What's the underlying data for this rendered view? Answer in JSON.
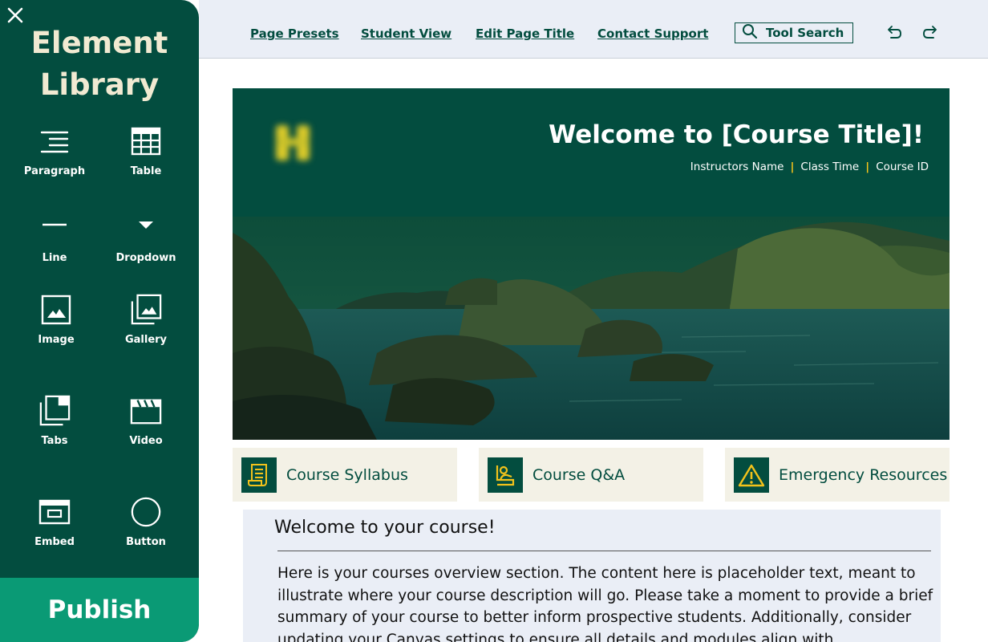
{
  "sidebar": {
    "title_line1": "Element",
    "title_line2": "Library",
    "items": [
      {
        "label": "Paragraph",
        "icon": "paragraph-icon"
      },
      {
        "label": "Table",
        "icon": "table-icon"
      },
      {
        "label": "Line",
        "icon": "line-icon"
      },
      {
        "label": "Dropdown",
        "icon": "dropdown-icon"
      },
      {
        "label": "Image",
        "icon": "image-icon"
      },
      {
        "label": "Gallery",
        "icon": "gallery-icon"
      },
      {
        "label": "Tabs",
        "icon": "tabs-icon"
      },
      {
        "label": "Video",
        "icon": "video-icon"
      },
      {
        "label": "Embed",
        "icon": "embed-icon"
      },
      {
        "label": "Button",
        "icon": "button-icon"
      }
    ],
    "publish_label": "Publish"
  },
  "topbar": {
    "links": [
      "Page Presets",
      "Student View",
      "Edit Page Title",
      "Contact Support"
    ],
    "tool_search_label": "Tool Search"
  },
  "banner": {
    "title": "Welcome to [Course Title]!",
    "meta": [
      "Instructors Name",
      "Class Time",
      "Course ID"
    ]
  },
  "quick_links": [
    {
      "label": "Course Syllabus",
      "icon": "syllabus-icon"
    },
    {
      "label": "Course Q&A",
      "icon": "qa-icon"
    },
    {
      "label": "Emergency Resources",
      "icon": "warning-icon"
    }
  ],
  "overview": {
    "title": "Welcome to your course!",
    "body": "Here is your courses overview section. The content here is placeholder text, meant to illustrate where your course description will go. Please take a moment to provide a brief summary of your course to better inform prospective students. Additionally, consider updating your Canvas settings to ensure all details and modules align with"
  },
  "colors": {
    "brand_dark": "#034d3f",
    "publish": "#0a9a75",
    "accent_gold": "#f2c21b",
    "cream": "#f1ead2",
    "card_bg": "#f3f1e6",
    "panel_bg": "#eaeef6"
  }
}
